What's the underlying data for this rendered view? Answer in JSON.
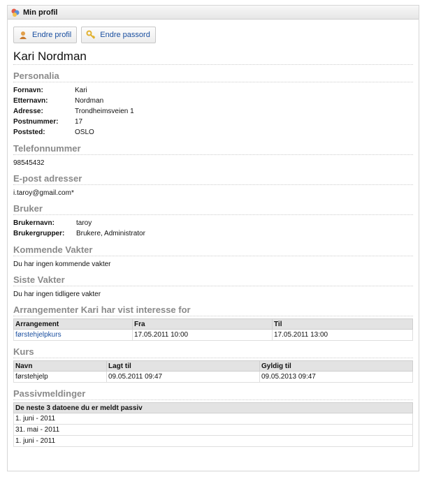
{
  "window": {
    "title": "Min profil",
    "icon": "profile-icon"
  },
  "buttons": {
    "edit_profile": "Endre profil",
    "edit_password": "Endre passord"
  },
  "user": {
    "full_name": "Kari Nordman"
  },
  "personalia": {
    "heading": "Personalia",
    "rows": [
      {
        "label": "Fornavn:",
        "value": "Kari"
      },
      {
        "label": "Etternavn:",
        "value": "Nordman"
      },
      {
        "label": "Adresse:",
        "value": "Trondheimsveien 1"
      },
      {
        "label": "Postnummer:",
        "value": "17"
      },
      {
        "label": "Poststed:",
        "value": "OSLO"
      }
    ]
  },
  "phone": {
    "heading": "Telefonnummer",
    "value": "98545432"
  },
  "email": {
    "heading": "E-post adresser",
    "value": "i.taroy@gmail.com*"
  },
  "bruker": {
    "heading": "Bruker",
    "rows": [
      {
        "label": "Brukernavn:",
        "value": "taroy"
      },
      {
        "label": "Brukergrupper:",
        "value": "Brukere, Administrator"
      }
    ]
  },
  "upcoming": {
    "heading": "Kommende Vakter",
    "text": "Du har ingen kommende vakter"
  },
  "past": {
    "heading": "Siste Vakter",
    "text": "Du har ingen tidligere vakter"
  },
  "interests": {
    "heading": "Arrangementer Kari har vist interesse for",
    "columns": [
      "Arrangement",
      "Fra",
      "Til"
    ],
    "rows": [
      [
        "førstehjelpkurs",
        "17.05.2011 10:00",
        "17.05.2011 13:00"
      ]
    ]
  },
  "courses": {
    "heading": "Kurs",
    "columns": [
      "Navn",
      "Lagt til",
      "Gyldig til"
    ],
    "rows": [
      [
        "førstehjelp",
        "09.05.2011 09:47",
        "09.05.2013 09:47"
      ]
    ]
  },
  "passive": {
    "heading": "Passivmeldinger",
    "columns": [
      "De neste 3 datoene du er meldt passiv"
    ],
    "rows": [
      [
        "1. juni - 2011"
      ],
      [
        "31. mai - 2011"
      ],
      [
        "1. juni - 2011"
      ]
    ]
  },
  "colors": {
    "link": "#1a4fa0",
    "heading": "#8a8a8a",
    "table_header": "#e3e3e3"
  }
}
